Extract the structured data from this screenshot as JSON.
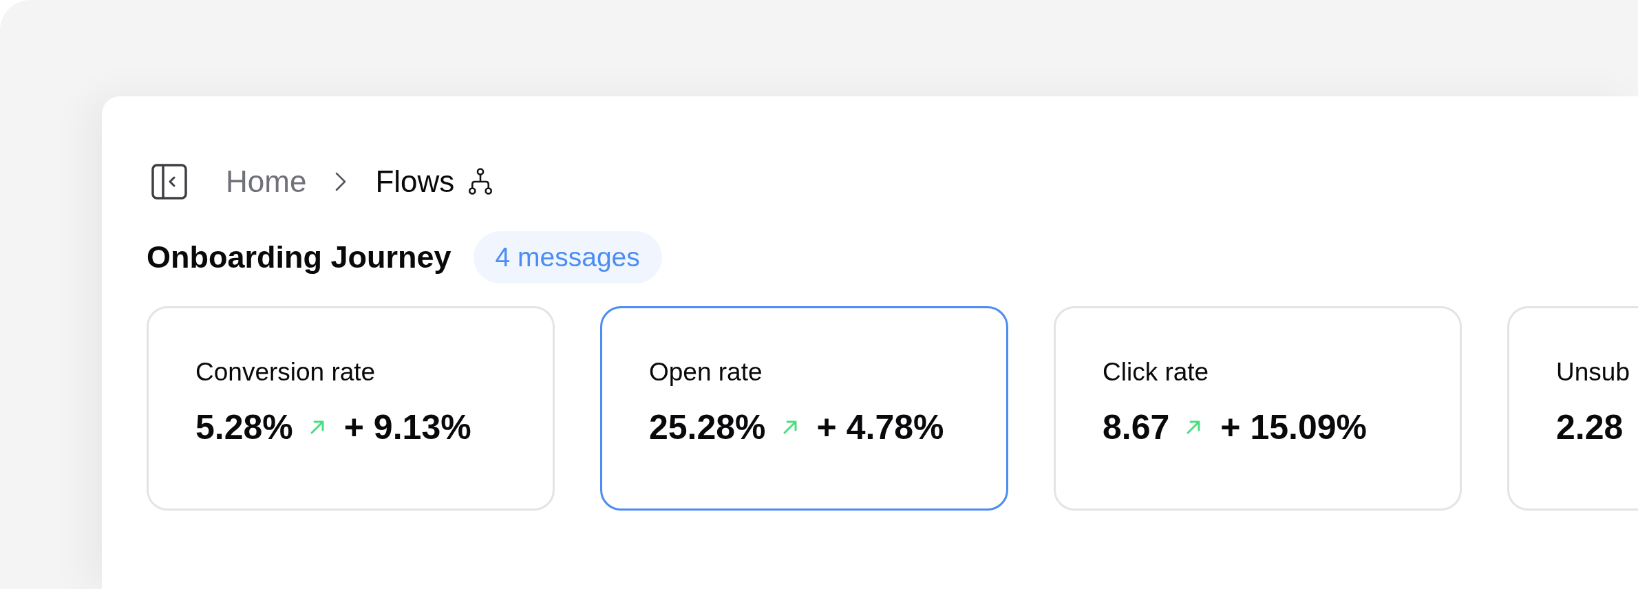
{
  "breadcrumb": {
    "items": [
      "Home",
      "Flows"
    ]
  },
  "flow": {
    "title": "Onboarding Journey",
    "badge": "4 messages"
  },
  "metrics": [
    {
      "label": "Conversion rate",
      "value": "5.28%",
      "change": "+ 9.13%",
      "selected": false
    },
    {
      "label": "Open rate",
      "value": "25.28%",
      "change": "+ 4.78%",
      "selected": true
    },
    {
      "label": "Click rate",
      "value": "8.67",
      "change": "+ 15.09%",
      "selected": false
    },
    {
      "label": "Unsub",
      "value": "2.28",
      "selected": false
    }
  ]
}
